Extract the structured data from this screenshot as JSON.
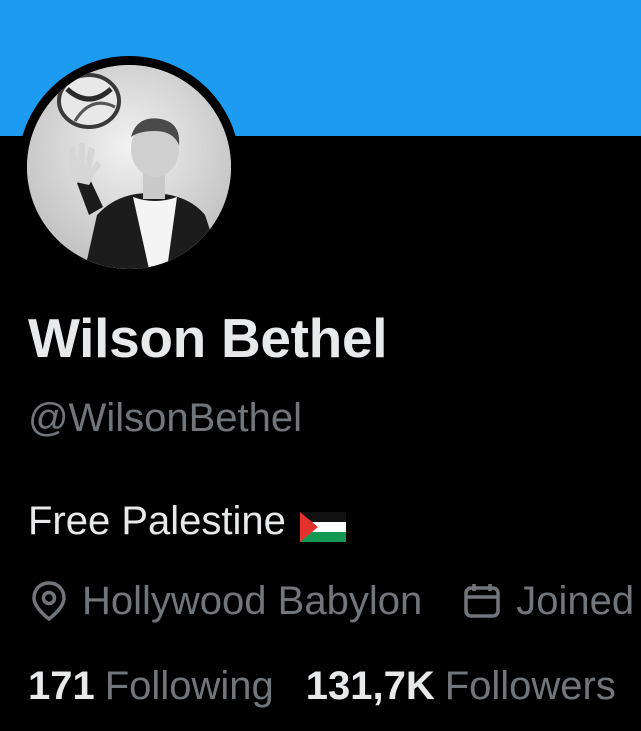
{
  "profile": {
    "display_name": "Wilson Bethel",
    "handle": "@WilsonBethel",
    "bio": "Free Palestine",
    "bio_flag_icon": "palestine-flag-icon",
    "location": "Hollywood Babylon",
    "joined_label": "Joined",
    "location_icon": "location-pin-icon",
    "calendar_icon": "calendar-icon"
  },
  "stats": {
    "following_count": "171",
    "following_label": "Following",
    "followers_count": "131,7K",
    "followers_label": "Followers"
  },
  "colors": {
    "banner": "#1d9bf0",
    "background": "#000000",
    "primary_text": "#e7e9ea",
    "secondary_text": "#71767b"
  }
}
